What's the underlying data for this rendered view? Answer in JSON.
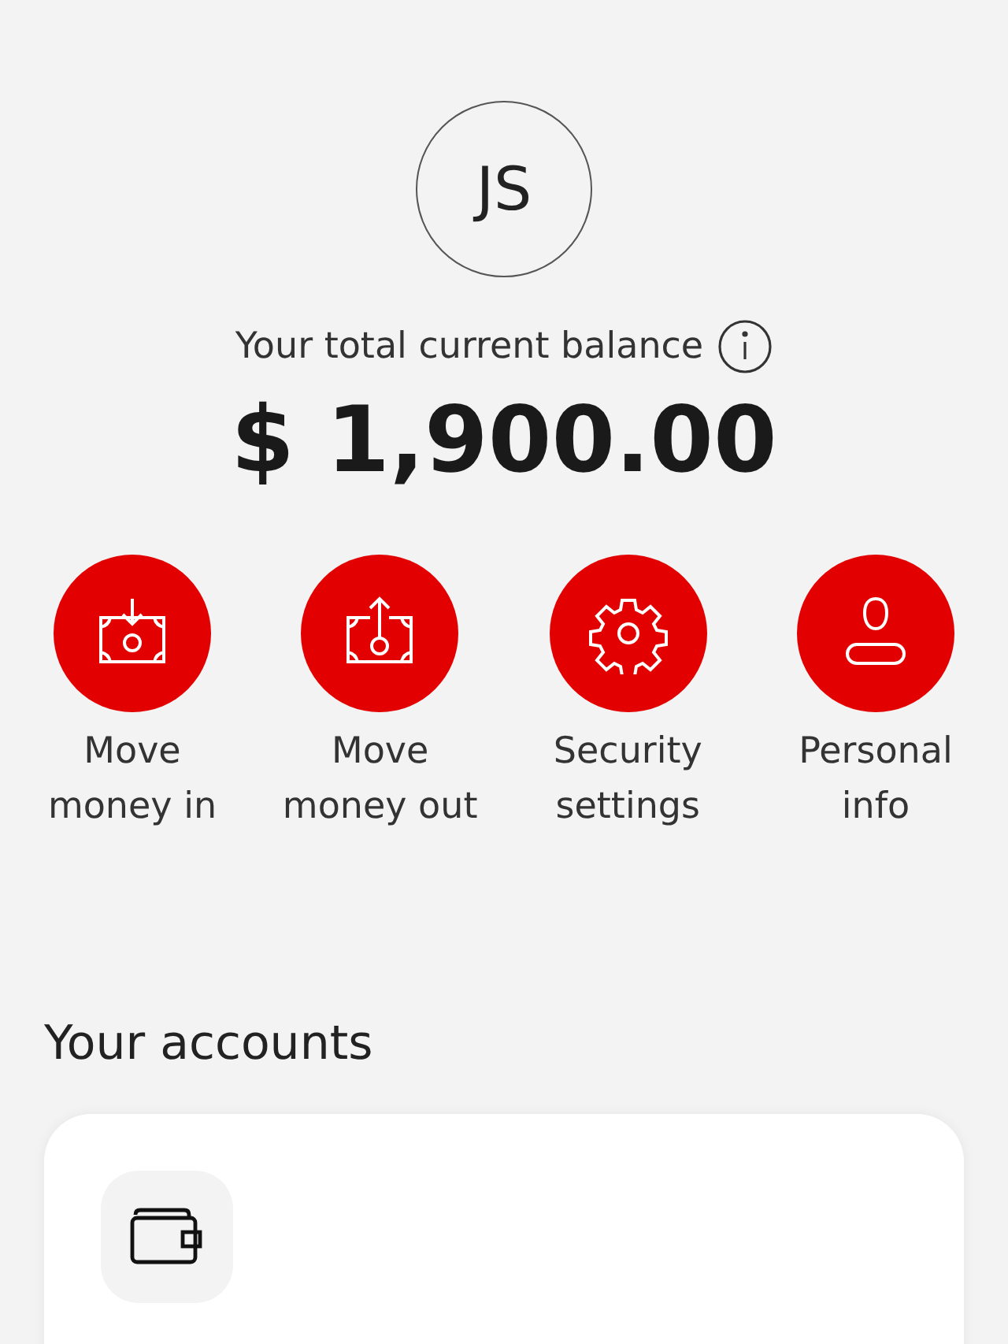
{
  "profile": {
    "initials": "JS"
  },
  "balance": {
    "label": "Your total current balance",
    "amount": "$ 1,900.00"
  },
  "actions": [
    {
      "kind": "money-in",
      "label": "Move money in"
    },
    {
      "kind": "money-out",
      "label": "Move money out"
    },
    {
      "kind": "security",
      "label": "Security settings"
    },
    {
      "kind": "personal",
      "label": "Personal info"
    }
  ],
  "accounts": {
    "title": "Your accounts"
  }
}
